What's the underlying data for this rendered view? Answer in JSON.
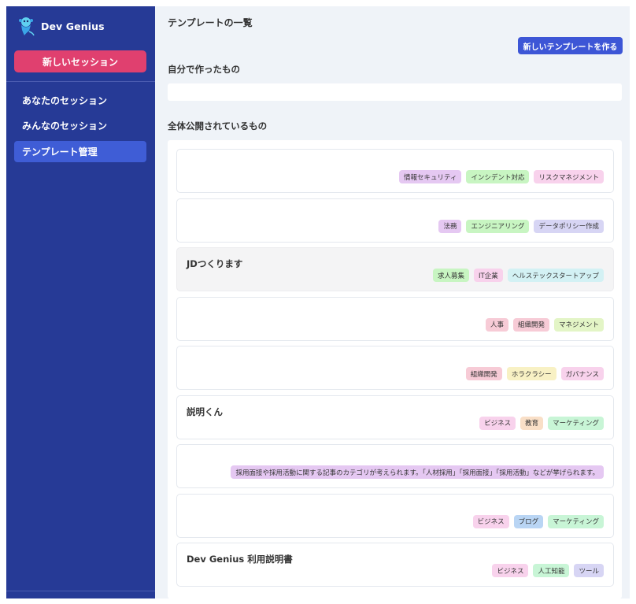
{
  "sidebar": {
    "brand": "Dev Genius",
    "new_session": "新しいセッション",
    "items": [
      {
        "label": "あなたのセッション",
        "active": false
      },
      {
        "label": "みんなのセッション",
        "active": false
      },
      {
        "label": "テンプレート管理",
        "active": true
      }
    ]
  },
  "main": {
    "title": "テンプレートの一覧",
    "create_button": "新しいテンプレートを作る",
    "own_section": "自分で作ったもの",
    "public_section": "全体公開されているもの"
  },
  "templates": [
    {
      "title": "",
      "tags": [
        {
          "label": "情報セキュリティ",
          "color": "#e5c8f2"
        },
        {
          "label": "インシデント対応",
          "color": "#c8f5c2"
        },
        {
          "label": "リスクマネジメント",
          "color": "#f8d2ec"
        }
      ]
    },
    {
      "title": "",
      "tags": [
        {
          "label": "法務",
          "color": "#e5c8f2"
        },
        {
          "label": "エンジニアリング",
          "color": "#c8f5c2"
        },
        {
          "label": "データポリシー作成",
          "color": "#d7d5f4"
        }
      ]
    },
    {
      "title": "JDつくります",
      "hover": true,
      "tags": [
        {
          "label": "求人募集",
          "color": "#c8f5c2"
        },
        {
          "label": "IT企業",
          "color": "#f8d2ec"
        },
        {
          "label": "ヘルステックスタートアップ",
          "color": "#d3f1f4"
        }
      ]
    },
    {
      "title": "",
      "tags": [
        {
          "label": "人事",
          "color": "#f7cbd6"
        },
        {
          "label": "組織開発",
          "color": "#f7cbd6"
        },
        {
          "label": "マネジメント",
          "color": "#e3f5c6"
        }
      ]
    },
    {
      "title": "",
      "tags": [
        {
          "label": "組織開発",
          "color": "#f7cbd6"
        },
        {
          "label": "ホラクラシー",
          "color": "#f8f1c4"
        },
        {
          "label": "ガバナンス",
          "color": "#f8d2ec"
        }
      ]
    },
    {
      "title": "説明くん",
      "tags": [
        {
          "label": "ビジネス",
          "color": "#f8d2ec"
        },
        {
          "label": "教育",
          "color": "#f9dfc7"
        },
        {
          "label": "マーケティング",
          "color": "#c8f5d6"
        }
      ]
    },
    {
      "title": "",
      "tags": [
        {
          "label": "採用面接や採用活動に関する記事のカテゴリが考えられます。「人材採用」「採用面接」「採用活動」などが挙げられます。",
          "color": "#e5c8f2"
        }
      ]
    },
    {
      "title": "",
      "tags": [
        {
          "label": "ビジネス",
          "color": "#f8d2ec"
        },
        {
          "label": "ブログ",
          "color": "#b9d5f4"
        },
        {
          "label": "マーケティング",
          "color": "#c8f5d6"
        }
      ]
    },
    {
      "title": "Dev Genius 利用説明書",
      "tags": [
        {
          "label": "ビジネス",
          "color": "#f8d2ec"
        },
        {
          "label": "人工知能",
          "color": "#c8f5d6"
        },
        {
          "label": "ツール",
          "color": "#d7d5f4"
        }
      ]
    }
  ]
}
